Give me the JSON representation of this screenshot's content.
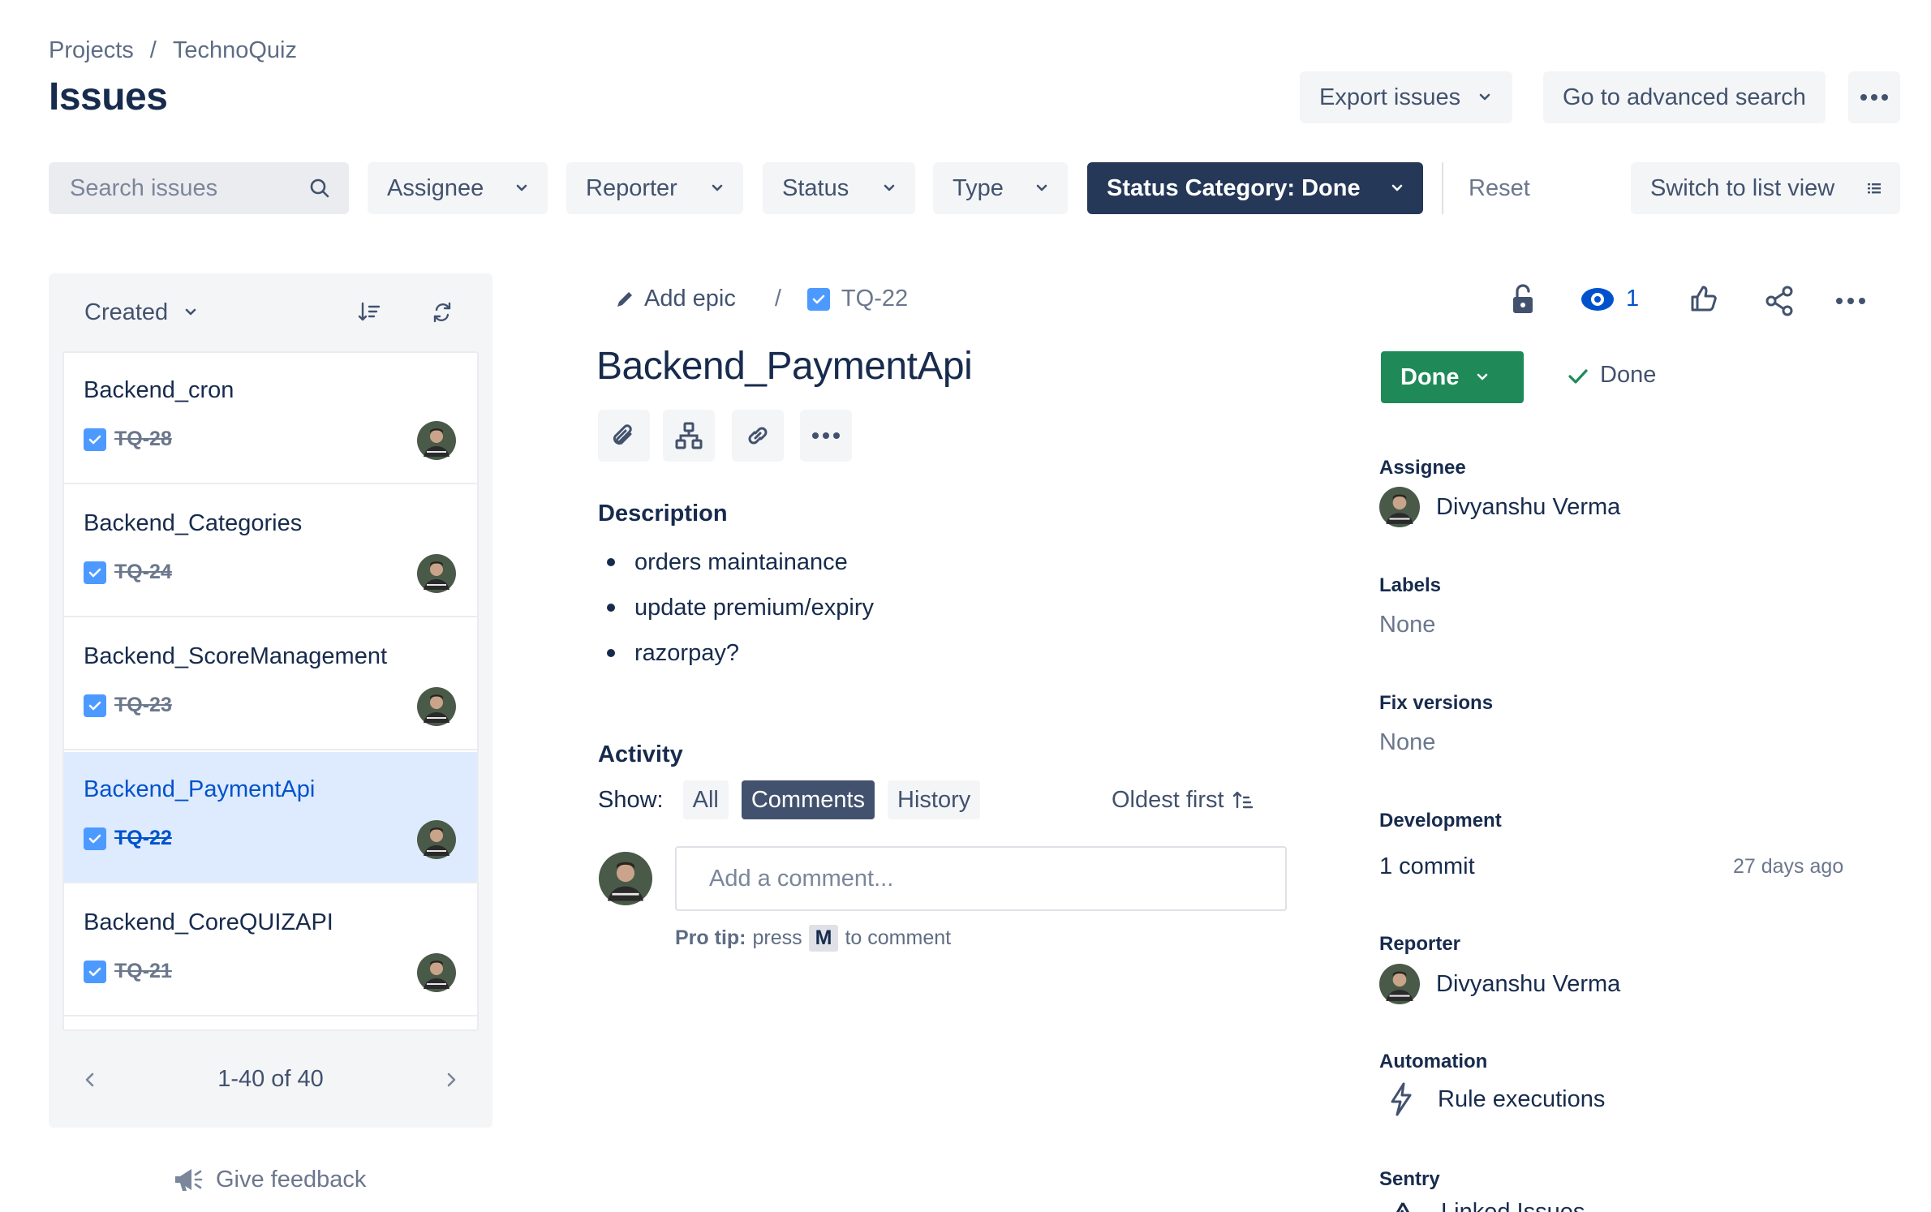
{
  "breadcrumb": {
    "projects": "Projects",
    "separator": "/",
    "project": "TechnoQuiz"
  },
  "page": {
    "title": "Issues"
  },
  "header_actions": {
    "export": "Export issues",
    "advanced_search": "Go to advanced search"
  },
  "filters": {
    "search_placeholder": "Search issues",
    "assignee": "Assignee",
    "reporter": "Reporter",
    "status": "Status",
    "type": "Type",
    "status_category": "Status Category: Done",
    "reset": "Reset",
    "switch_view": "Switch to list view"
  },
  "list": {
    "sort_label": "Created",
    "items": [
      {
        "title": "Backend_cron",
        "key": "TQ-28",
        "selected": false
      },
      {
        "title": "Backend_Categories",
        "key": "TQ-24",
        "selected": false
      },
      {
        "title": "Backend_ScoreManagement",
        "key": "TQ-23",
        "selected": false
      },
      {
        "title": "Backend_PaymentApi",
        "key": "TQ-22",
        "selected": true
      },
      {
        "title": "Backend_CoreQUIZAPI",
        "key": "TQ-21",
        "selected": false
      }
    ],
    "pagination": "1-40 of 40",
    "feedback": "Give feedback"
  },
  "issue": {
    "add_epic": "Add epic",
    "separator": "/",
    "key": "TQ-22",
    "title": "Backend_PaymentApi",
    "watchers": "1",
    "description_heading": "Description",
    "description": [
      "orders maintainance",
      "update premium/expiry",
      "razorpay?"
    ],
    "activity_heading": "Activity",
    "show_label": "Show:",
    "tabs": {
      "all": "All",
      "comments": "Comments",
      "history": "History"
    },
    "order": "Oldest first",
    "comment_placeholder": "Add a comment...",
    "protip": {
      "lead": "Pro tip:",
      "press": "press",
      "key": "M",
      "tail": "to comment"
    }
  },
  "details": {
    "status_button": "Done",
    "resolution": "Done",
    "assignee_label": "Assignee",
    "assignee": "Divyanshu Verma",
    "labels_label": "Labels",
    "labels": "None",
    "fix_versions_label": "Fix versions",
    "fix_versions": "None",
    "development_label": "Development",
    "commit": "1 commit",
    "commit_time": "27 days ago",
    "reporter_label": "Reporter",
    "reporter": "Divyanshu Verma",
    "automation_label": "Automation",
    "rule_executions": "Rule executions",
    "sentry_label": "Sentry",
    "linked_issues": "Linked Issues"
  },
  "colors": {
    "primary_text": "#172b4d",
    "active_filter": "#253858",
    "done_green": "#1f8a58",
    "selection": "#deebff",
    "link_blue": "#0052cc"
  }
}
